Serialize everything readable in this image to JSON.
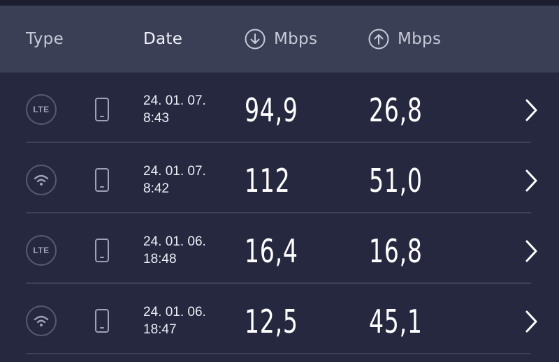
{
  "header": {
    "type_label": "Type",
    "date_label": "Date",
    "download_label": "Mbps",
    "upload_label": "Mbps",
    "download_icon": "arrow-down-circle-icon",
    "upload_icon": "arrow-up-circle-icon"
  },
  "results": [
    {
      "type": "LTE",
      "type_icon": "lte-icon",
      "device_icon": "phone-icon",
      "date": "24. 01. 07.",
      "time": "8:43",
      "download": "94,9",
      "upload": "26,8"
    },
    {
      "type": "wifi",
      "type_icon": "wifi-icon",
      "device_icon": "phone-icon",
      "date": "24. 01. 07.",
      "time": "8:42",
      "download": "112",
      "upload": "51,0"
    },
    {
      "type": "LTE",
      "type_icon": "lte-icon",
      "device_icon": "phone-icon",
      "date": "24. 01. 06.",
      "time": "18:48",
      "download": "16,4",
      "upload": "16,8"
    },
    {
      "type": "wifi",
      "type_icon": "wifi-icon",
      "device_icon": "phone-icon",
      "date": "24. 01. 06.",
      "time": "18:47",
      "download": "12,5",
      "upload": "45,1"
    }
  ],
  "colors": {
    "background": "#262840",
    "header_background": "#3a3f56",
    "divider": "#3c4058",
    "text_primary": "#ffffff"
  }
}
